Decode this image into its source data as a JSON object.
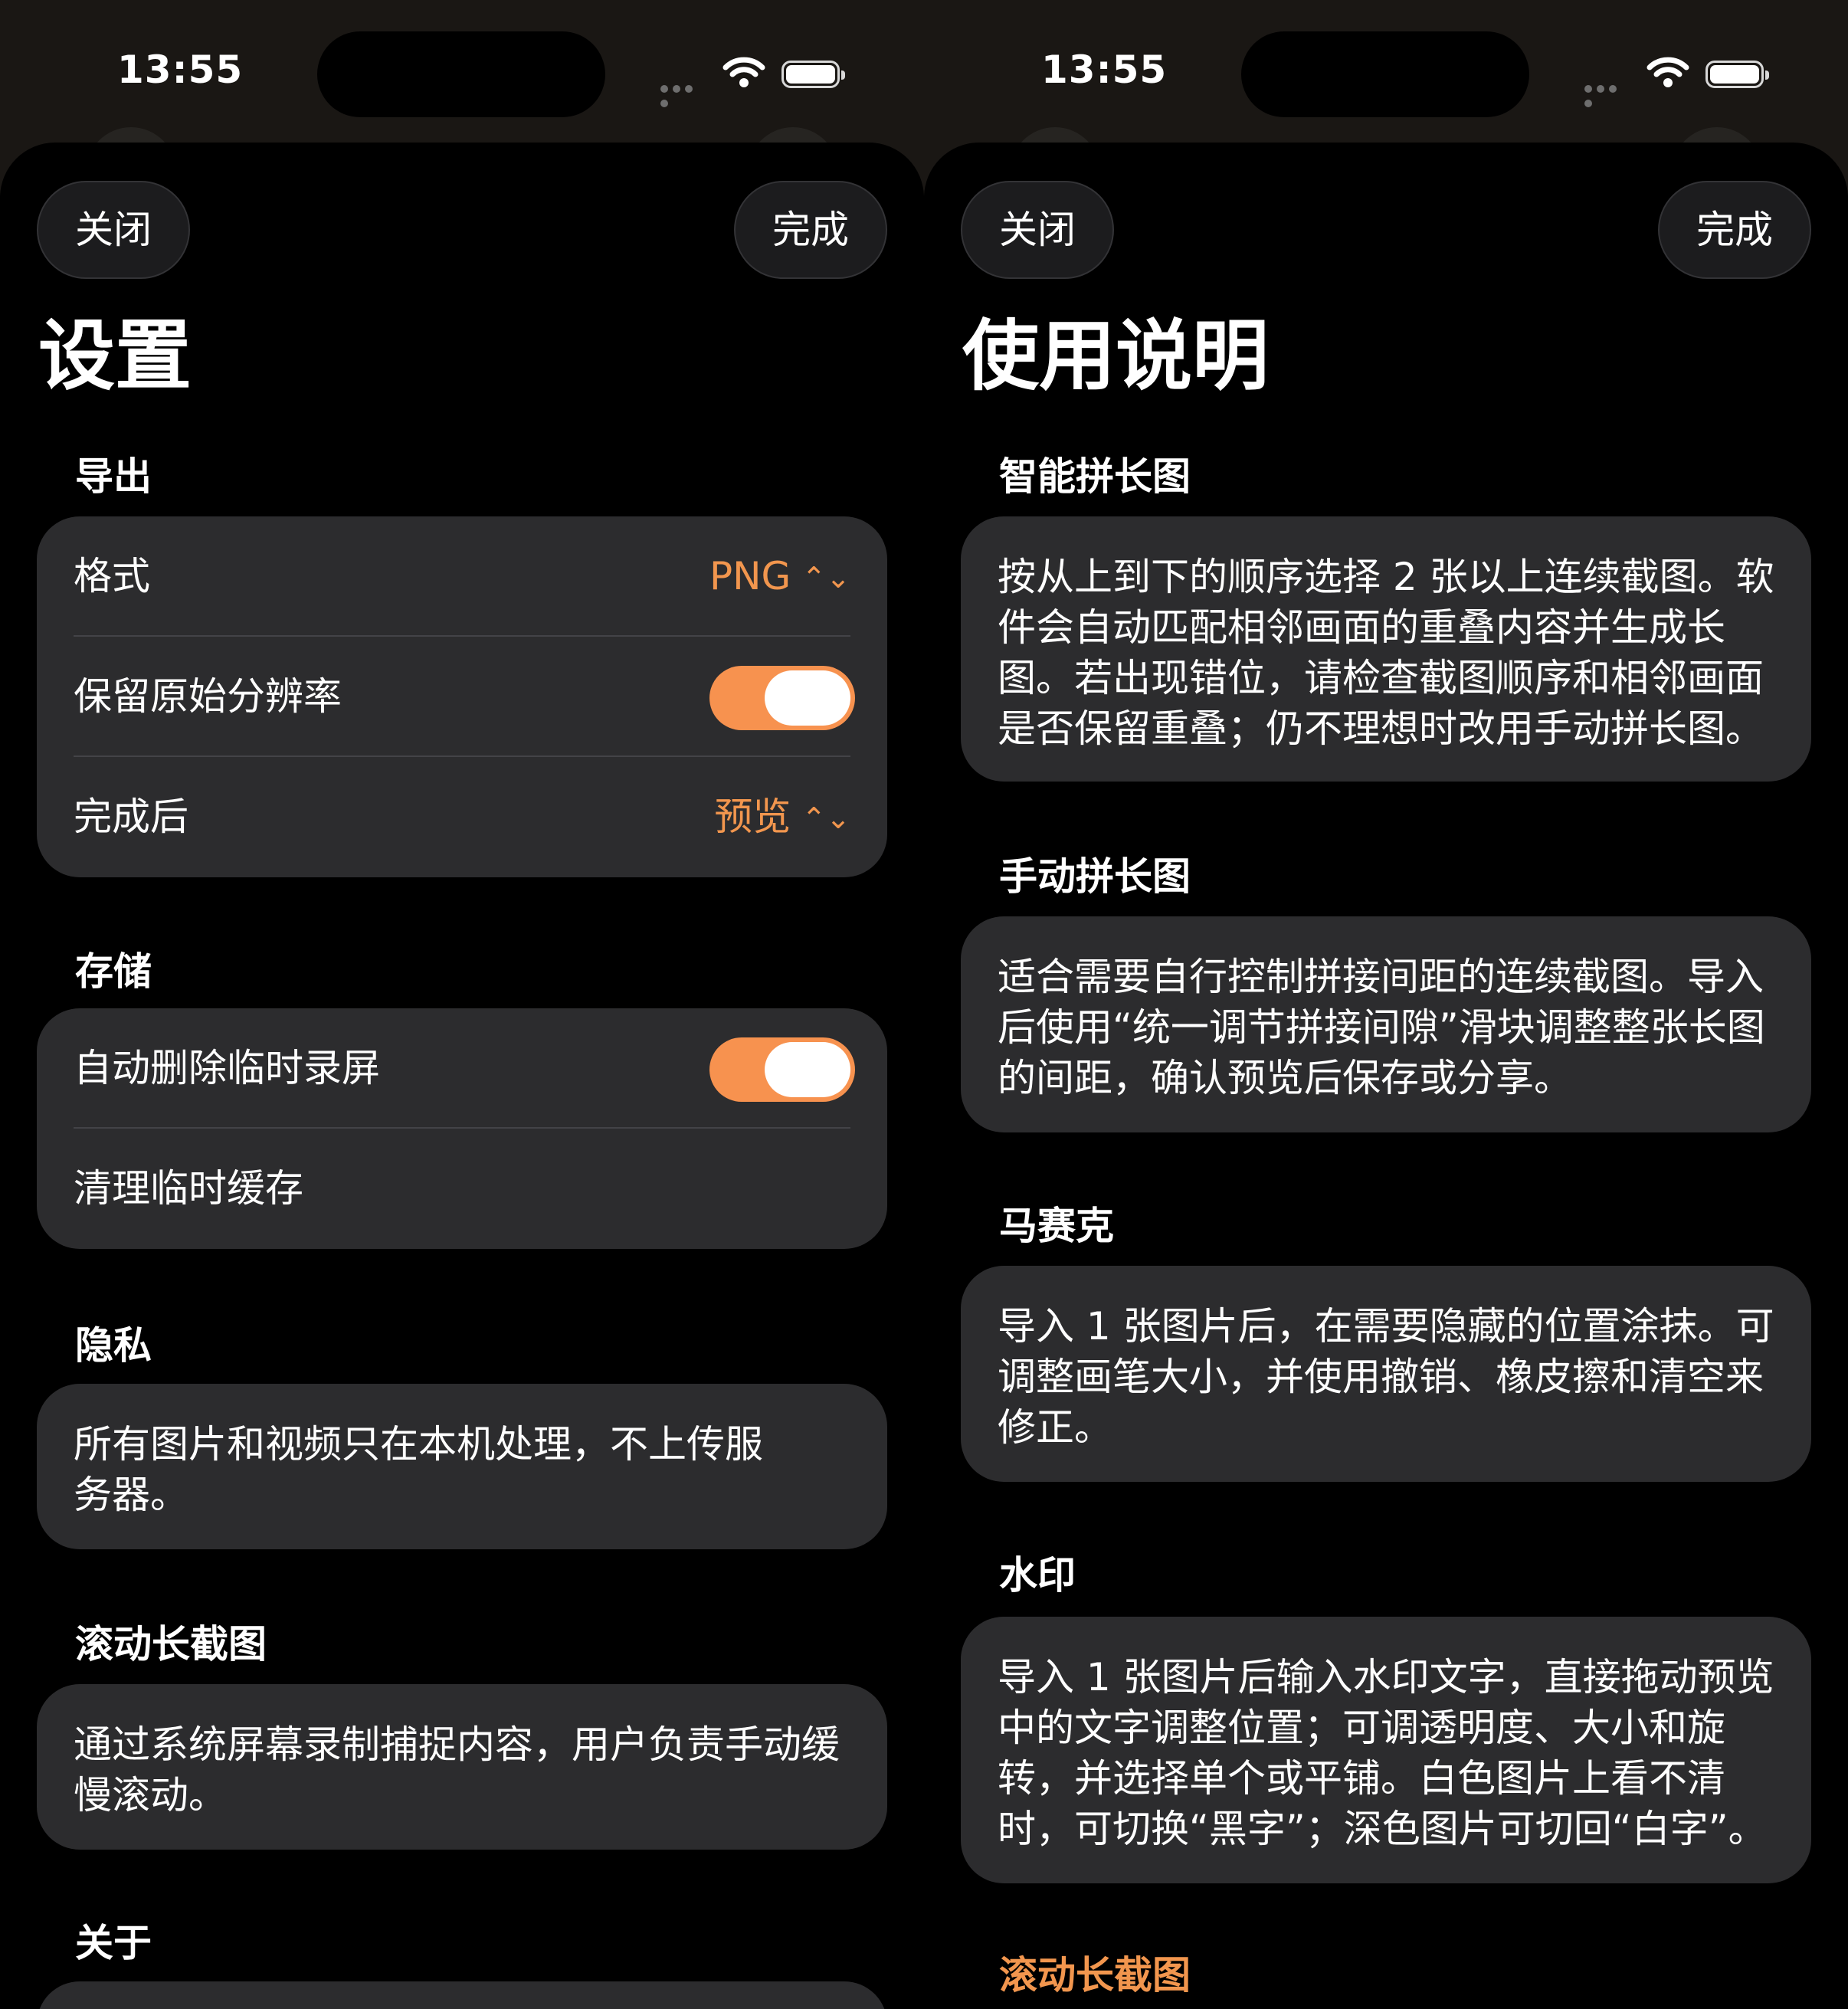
{
  "status": {
    "time": "13:55"
  },
  "settings": {
    "close_label": "关闭",
    "done_label": "完成",
    "title": "设置",
    "export": {
      "header": "导出",
      "format_label": "格式",
      "format_value": "PNG",
      "keep_resolution_label": "保留原始分辨率",
      "keep_resolution_on": true,
      "after_done_label": "完成后",
      "after_done_value": "预览"
    },
    "storage": {
      "header": "存储",
      "auto_delete_label": "自动删除临时录屏",
      "auto_delete_on": true,
      "clear_cache_label": "清理临时缓存"
    },
    "privacy": {
      "header": "隐私",
      "text": "所有图片和视频只在本机处理，不上传服务器。"
    },
    "scroll": {
      "header": "滚动长截图",
      "text": "通过系统屏幕录制捕捉内容，用户负责手动缓慢滚动。"
    },
    "about": {
      "header": "关于"
    }
  },
  "help": {
    "close_label": "关闭",
    "done_label": "完成",
    "title": "使用说明",
    "sections": [
      {
        "header": "智能拼长图",
        "text": "按从上到下的顺序选择 2 张以上连续截图。软件会自动匹配相邻画面的重叠内容并生成长图。若出现错位，请检查截图顺序和相邻画面是否保留重叠；仍不理想时改用手动拼长图。"
      },
      {
        "header": "手动拼长图",
        "text": "适合需要自行控制拼接间距的连续截图。导入后使用“统一调节拼接间隙”滑块调整整张长图的间距，确认预览后保存或分享。"
      },
      {
        "header": "马赛克",
        "text": "导入 1 张图片后，在需要隐藏的位置涂抹。可调整画笔大小，并使用撤销、橡皮擦和清空来修正。"
      },
      {
        "header": "水印",
        "text": "导入 1 张图片后输入水印文字，直接拖动预览中的文字调整位置；可调透明度、大小和旋转，并选择单个或平铺。白色图片上看不清时，可切换“黑字”；深色图片可切回“白字”。"
      },
      {
        "header": "滚动长截图"
      }
    ]
  },
  "colors": {
    "accent": "#F2964E",
    "card": "#2C2C2E",
    "background": "#000000"
  }
}
